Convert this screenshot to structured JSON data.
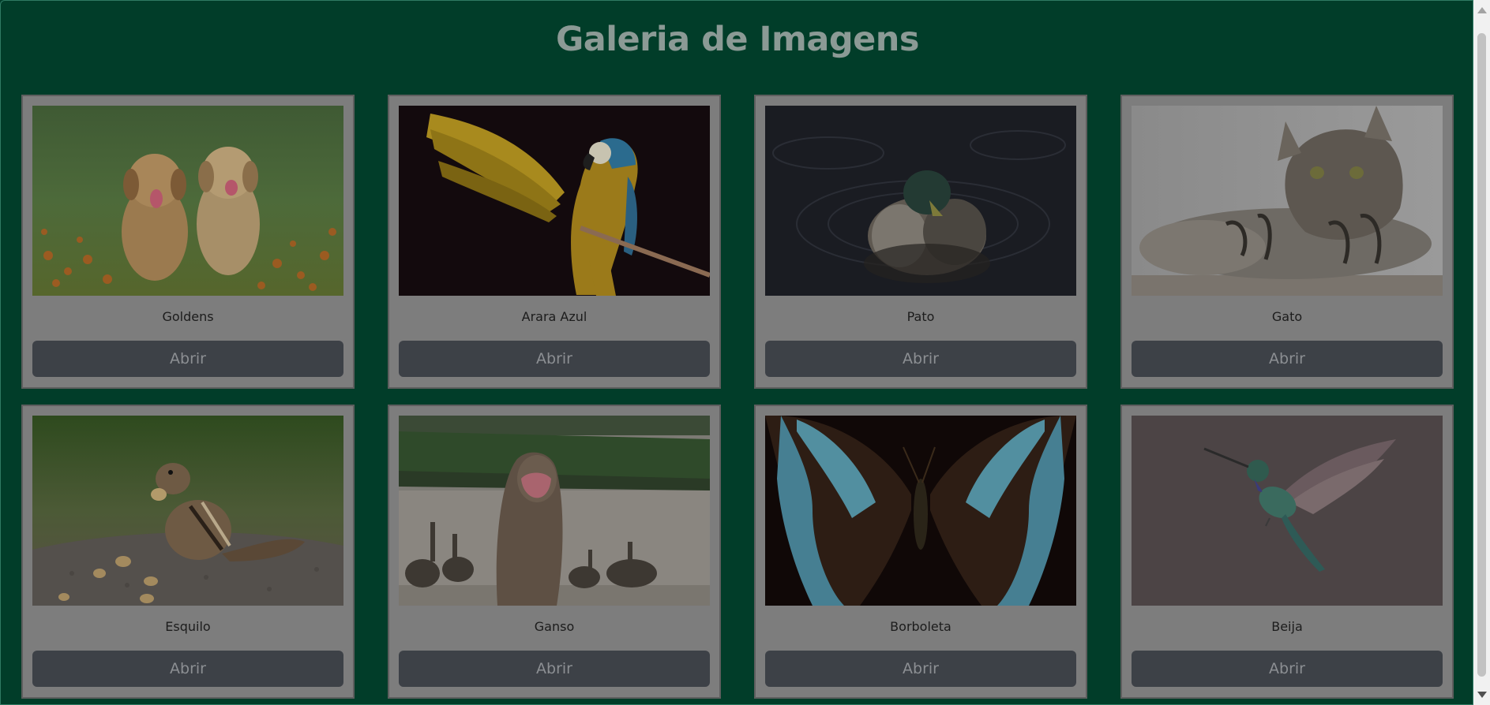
{
  "header": {
    "title": "Galeria de Imagens"
  },
  "gallery": {
    "cards": [
      {
        "caption": "Goldens",
        "button": "Abrir",
        "image_icon": "puppies-photo"
      },
      {
        "caption": "Arara Azul",
        "button": "Abrir",
        "image_icon": "macaw-photo"
      },
      {
        "caption": "Pato",
        "button": "Abrir",
        "image_icon": "duck-photo"
      },
      {
        "caption": "Gato",
        "button": "Abrir",
        "image_icon": "cat-photo"
      },
      {
        "caption": "Esquilo",
        "button": "Abrir",
        "image_icon": "chipmunk-photo"
      },
      {
        "caption": "Ganso",
        "button": "Abrir",
        "image_icon": "goose-photo"
      },
      {
        "caption": "Borboleta",
        "button": "Abrir",
        "image_icon": "butterfly-photo"
      },
      {
        "caption": "Beija",
        "button": "Abrir",
        "image_icon": "hummingbird-photo"
      }
    ]
  },
  "colors": {
    "page_background": "#013d29",
    "card_background": "#7d7d7d",
    "button_background": "#3d4147"
  }
}
